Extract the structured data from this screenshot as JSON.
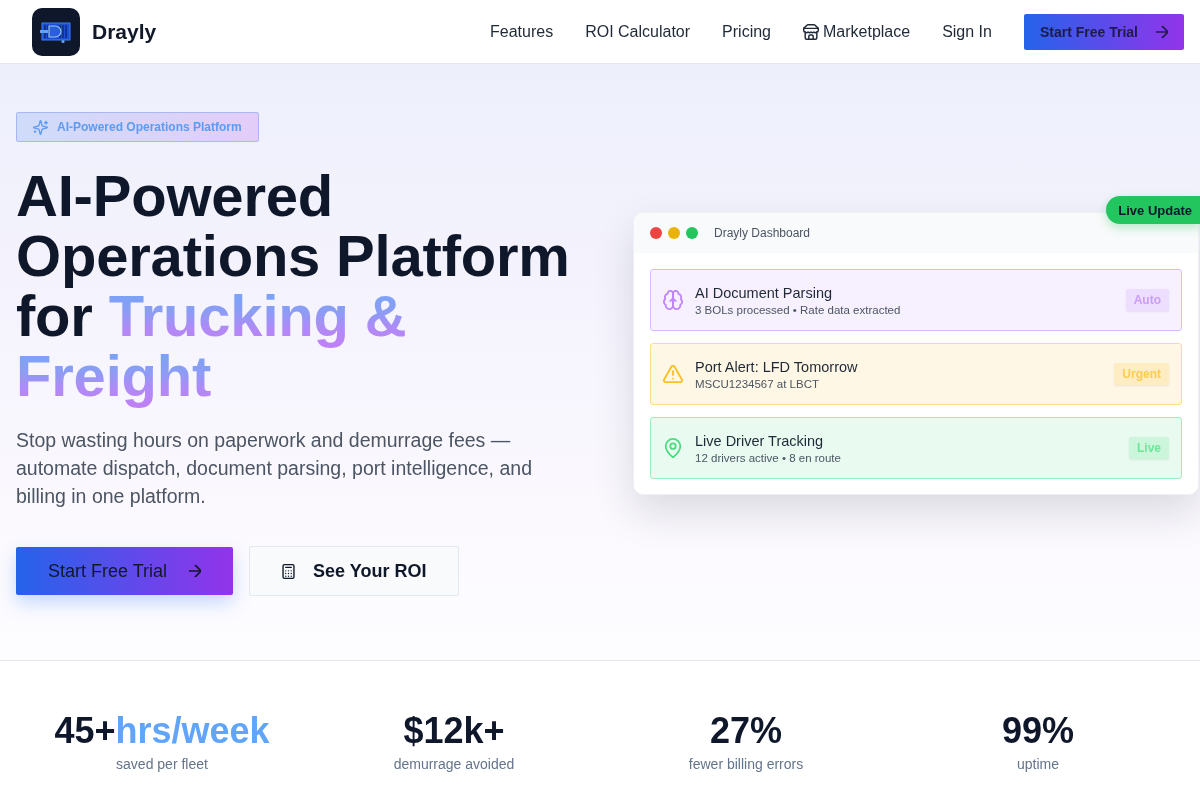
{
  "header": {
    "brand": "Drayly",
    "nav": [
      {
        "label": "Features",
        "kind": "link"
      },
      {
        "label": "ROI Calculator",
        "kind": "link"
      },
      {
        "label": "Pricing",
        "kind": "link"
      },
      {
        "label": "Marketplace",
        "kind": "store"
      },
      {
        "label": "Sign In",
        "kind": "link"
      }
    ],
    "cta": "Start Free Trial"
  },
  "hero": {
    "badge": "AI-Powered Operations Platform",
    "headline": "AI-Powered Operations Platform for",
    "headline_highlight": "Trucking & Freight",
    "description": "Stop wasting hours on paperwork and demurrage fees — automate dispatch, document parsing, port intelligence, and billing in one platform.",
    "buttons": [
      {
        "label": "Start Free Trial",
        "kind": "primary"
      },
      {
        "label": "See Your ROI",
        "kind": "secondary"
      }
    ]
  },
  "dashboard": {
    "title": "Drayly Dashboard",
    "live_tag": "Live Update",
    "items": [
      {
        "kind": "parsing",
        "color": "#c084fc",
        "title": "AI Document Parsing",
        "subtitle": "3 BOLs processed • Rate data extracted",
        "tag": "Auto"
      },
      {
        "kind": "alert",
        "color": "#fbbf24",
        "title": "Port Alert: LFD Tomorrow",
        "subtitle": "MSCU1234567 at LBCT",
        "tag": "Urgent"
      },
      {
        "kind": "tracking",
        "color": "#4ade80",
        "title": "Live Driver Tracking",
        "subtitle": "12 drivers active • 8 en route",
        "tag": "Live"
      }
    ]
  },
  "stats": [
    {
      "value": "45+",
      "unit": "hrs/week",
      "label": "saved per fleet"
    },
    {
      "value": "$12k+",
      "label": "demurrage avoided"
    },
    {
      "value": "27%",
      "label": "fewer billing errors"
    },
    {
      "value": "99%",
      "label": "uptime"
    }
  ]
}
